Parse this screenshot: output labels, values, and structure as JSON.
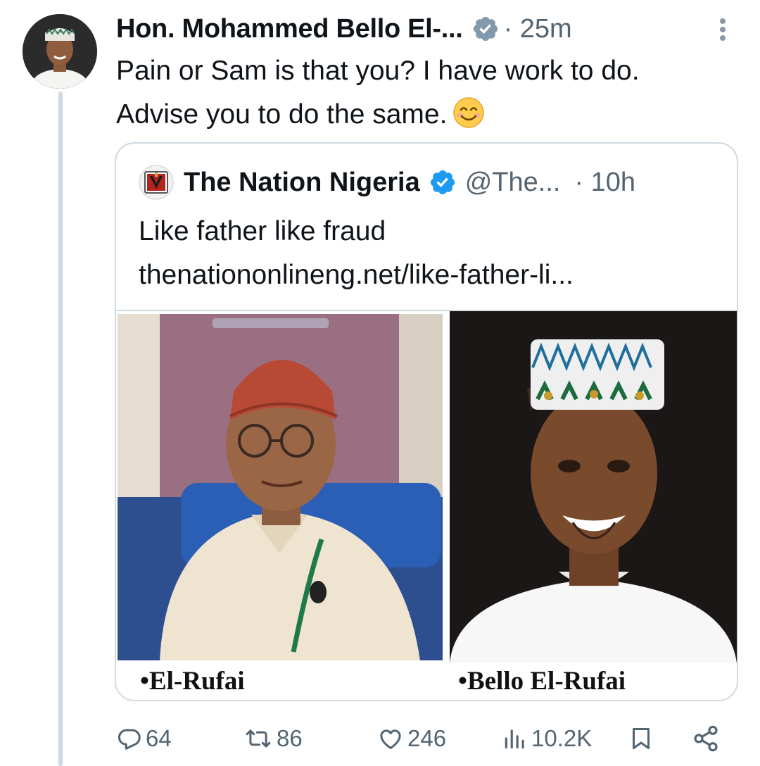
{
  "tweet": {
    "author_name": "Hon. Mohammed Bello El-...",
    "time": "· 25m",
    "text_line1": "Pain or Sam is that you? I have work to do.",
    "text_line2": "Advise you to do the same."
  },
  "quoted": {
    "name": "The Nation Nigeria",
    "handle": "@The...",
    "time": "· 10h",
    "text": "Like father like fraud",
    "link": "thenationonlineng.net/like-father-li...",
    "captions": {
      "left": "•El-Rufai",
      "right": "•Bello El-Rufai"
    }
  },
  "actions": {
    "replies": "64",
    "reposts": "86",
    "likes": "246",
    "views": "10.2K"
  },
  "colors": {
    "verified_blue": "#1d9bf0",
    "verified_gray": "#829aab",
    "muted_text": "#536471",
    "border": "#cfd9de"
  },
  "icons": [
    "more-icon",
    "verified-icon",
    "reply-icon",
    "repost-icon",
    "like-icon",
    "views-icon",
    "bookmark-icon",
    "share-icon"
  ]
}
